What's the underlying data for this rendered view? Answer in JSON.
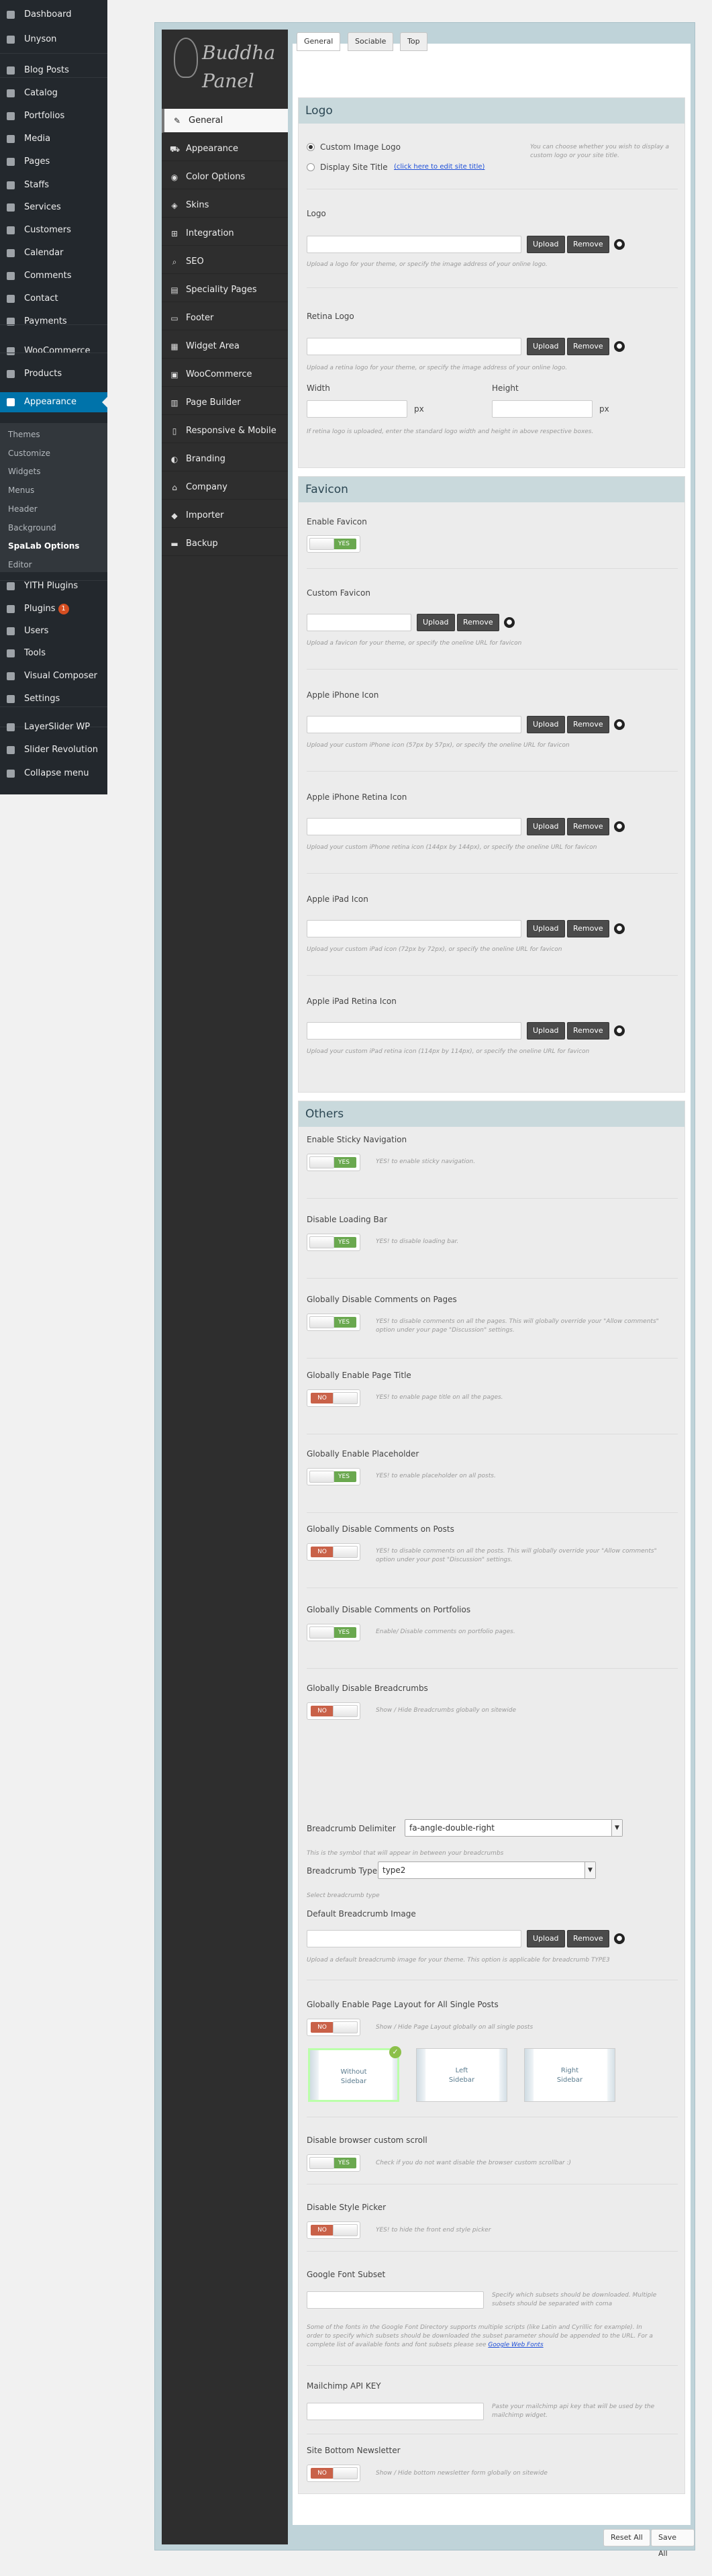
{
  "wp_menu": {
    "items": [
      {
        "label": "Dashboard",
        "icon": "dashboard-icon"
      },
      {
        "label": "Unyson",
        "icon": "unyson-icon"
      },
      {
        "label": "Blog Posts",
        "icon": "pin-icon"
      },
      {
        "label": "Catalog",
        "icon": "catalog-icon"
      },
      {
        "label": "Portfolios",
        "icon": "portfolio-icon"
      },
      {
        "label": "Media",
        "icon": "media-icon"
      },
      {
        "label": "Pages",
        "icon": "pages-icon"
      },
      {
        "label": "Staffs",
        "icon": "staff-icon"
      },
      {
        "label": "Services",
        "icon": "services-icon"
      },
      {
        "label": "Customers",
        "icon": "customers-icon"
      },
      {
        "label": "Calendar",
        "icon": "calendar-icon"
      },
      {
        "label": "Comments",
        "icon": "comments-icon"
      },
      {
        "label": "Contact",
        "icon": "contact-icon"
      },
      {
        "label": "Payments",
        "icon": "payments-icon"
      },
      {
        "label": "WooCommerce",
        "icon": "woocommerce-icon"
      },
      {
        "label": "Products",
        "icon": "products-icon"
      },
      {
        "label": "Appearance",
        "icon": "brush-icon"
      }
    ],
    "submenu": [
      "Themes",
      "Customize",
      "Widgets",
      "Menus",
      "Header",
      "Background",
      "SpaLab Options",
      "Editor"
    ],
    "items_bottom": [
      {
        "label": "YITH Plugins",
        "icon": "yith-icon"
      },
      {
        "label": "Plugins",
        "icon": "plugins-icon",
        "badge": "1"
      },
      {
        "label": "Users",
        "icon": "users-icon"
      },
      {
        "label": "Tools",
        "icon": "tools-icon"
      },
      {
        "label": "Visual Composer",
        "icon": "visual-composer-icon"
      },
      {
        "label": "Settings",
        "icon": "settings-icon"
      },
      {
        "label": "LayerSlider WP",
        "icon": "layerslider-icon"
      },
      {
        "label": "Slider Revolution",
        "icon": "slider-revolution-icon"
      },
      {
        "label": "Collapse menu",
        "icon": "collapse-icon"
      }
    ]
  },
  "panel": {
    "logo_line1": "Buddha",
    "logo_line2": "Panel",
    "nav": [
      {
        "label": "General",
        "icon": "wrench-icon"
      },
      {
        "label": "Appearance",
        "icon": "car-icon"
      },
      {
        "label": "Color Options",
        "icon": "palette-icon"
      },
      {
        "label": "Skins",
        "icon": "skins-icon"
      },
      {
        "label": "Integration",
        "icon": "integration-icon"
      },
      {
        "label": "SEO",
        "icon": "search-icon"
      },
      {
        "label": "Speciality Pages",
        "icon": "pages-icon"
      },
      {
        "label": "Footer",
        "icon": "footer-icon"
      },
      {
        "label": "Widget Area",
        "icon": "widget-icon"
      },
      {
        "label": "WooCommerce",
        "icon": "cart-icon"
      },
      {
        "label": "Page Builder",
        "icon": "builder-icon"
      },
      {
        "label": "Responsive & Mobile",
        "icon": "mobile-icon"
      },
      {
        "label": "Branding",
        "icon": "bulb-icon"
      },
      {
        "label": "Company",
        "icon": "company-icon"
      },
      {
        "label": "Importer",
        "icon": "importer-icon"
      },
      {
        "label": "Backup",
        "icon": "backup-icon"
      }
    ],
    "tabs": [
      "General",
      "Sociable",
      "Top"
    ]
  },
  "buttons": {
    "upload": "Upload",
    "remove": "Remove",
    "reset": "Reset All",
    "save": "Save All",
    "yes": "YES",
    "no": "NO"
  },
  "logo_section": {
    "title": "Logo",
    "radio_image": "Custom Image Logo",
    "radio_title": "Display Site Title",
    "radio_title_link": "(click here to edit site title)",
    "radio_desc": "You can choose whether you wish to display a custom logo or your site title.",
    "logo_label": "Logo",
    "logo_desc": "Upload a logo for your theme, or specify the image address of your online logo.",
    "retina_label": "Retina Logo",
    "retina_desc": "Upload a retina logo for your theme, or specify the image address of your online logo.",
    "width_label": "Width",
    "height_label": "Height",
    "px": "px",
    "wh_desc": "If retina logo is uploaded, enter the standard logo width and height in above respective boxes."
  },
  "favicon_section": {
    "title": "Favicon",
    "enable_label": "Enable Favicon",
    "fields": [
      {
        "label": "Custom Favicon",
        "desc": "Upload a favicon for your theme, or specify the oneline URL for favicon"
      },
      {
        "label": "Apple iPhone Icon",
        "desc": "Upload your custom iPhone icon (57px by 57px), or specify the oneline URL for favicon"
      },
      {
        "label": "Apple iPhone Retina Icon",
        "desc": "Upload your custom iPhone retina icon (144px by 144px), or specify the oneline URL for favicon"
      },
      {
        "label": "Apple iPad Icon",
        "desc": "Upload your custom iPad icon (72px by 72px), or specify the oneline URL for favicon"
      },
      {
        "label": "Apple iPad Retina Icon",
        "desc": "Upload your custom iPad retina icon (114px by 114px), or specify the oneline URL for favicon"
      }
    ]
  },
  "others_section": {
    "title": "Others",
    "toggles": [
      {
        "label": "Enable Sticky Navigation",
        "state": "YES",
        "desc": "YES! to enable sticky navigation."
      },
      {
        "label": "Disable Loading Bar",
        "state": "YES",
        "desc": "YES! to disable loading bar."
      },
      {
        "label": "Globally Disable Comments on Pages",
        "state": "YES",
        "desc": "YES! to disable comments on all the pages. This will globally override your \"Allow comments\" option under your page \"Discussion\" settings."
      },
      {
        "label": "Globally Enable Page Title",
        "state": "NO",
        "desc": "YES! to enable page title on all the pages."
      },
      {
        "label": "Globally Enable Placeholder",
        "state": "YES",
        "desc": "YES! to enable placeholder on all posts."
      },
      {
        "label": "Globally Disable Comments on Posts",
        "state": "NO",
        "desc": "YES! to disable comments on all the posts. This will globally override your \"Allow comments\" option under your post \"Discussion\" settings."
      },
      {
        "label": "Globally Disable Comments on Portfolios",
        "state": "YES",
        "desc": "Enable/ Disable comments on portfolio pages."
      },
      {
        "label": "Globally Disable Breadcrumbs",
        "state": "NO",
        "desc": "Show / Hide Breadcrumbs globally on sitewide"
      }
    ],
    "delimiter_label": "Breadcrumb Delimiter",
    "delimiter_value": "fa-angle-double-right",
    "delimiter_desc": "This is the symbol that will appear in between your breadcrumbs",
    "type_label": "Breadcrumb Type",
    "type_value": "type2",
    "type_desc": "Select breadcrumb type",
    "bc_image_label": "Default Breadcrumb Image",
    "bc_image_desc": "Upload a default breadcrumb image for your theme. This option is applicable for breadcrumb TYPE3",
    "layout_label": "Globally Enable Page Layout for All Single Posts",
    "layout_state": "NO",
    "layout_desc": "Show / Hide Page Layout globally on all single posts",
    "layouts": [
      {
        "line1": "Without",
        "line2": "Sidebar"
      },
      {
        "line1": "Left",
        "line2": "Sidebar"
      },
      {
        "line1": "Right",
        "line2": "Sidebar"
      }
    ],
    "scroll_label": "Disable browser custom scroll",
    "scroll_state": "YES",
    "scroll_desc": "Check if you do not want disable the browser custom scrollbar :)",
    "picker_label": "Disable Style Picker",
    "picker_state": "NO",
    "picker_desc": "YES! to hide the front end style picker",
    "font_label": "Google Font Subset",
    "font_side_desc": "Specify which subsets should be downloaded. Multiple subsets should be separated with coma",
    "font_desc1": "Some of the fonts in the Google Font Directory supports multiple scripts (like Latin and Cyrillic for example). In",
    "font_desc2": "order to specify which subsets should be downloaded the subset parameter should be appended to the URL. For a",
    "font_desc3": "complete list of available fonts and font subsets please see",
    "font_link": "Google Web Fonts",
    "mailchimp_label": "Mailchimp API KEY",
    "mailchimp_desc": "Paste your mailchimp api key that will be used by the mailchimp widget.",
    "newsletter_label": "Site Bottom Newsletter",
    "newsletter_state": "NO",
    "newsletter_desc": "Show / Hide bottom newsletter form globally on sitewide"
  }
}
